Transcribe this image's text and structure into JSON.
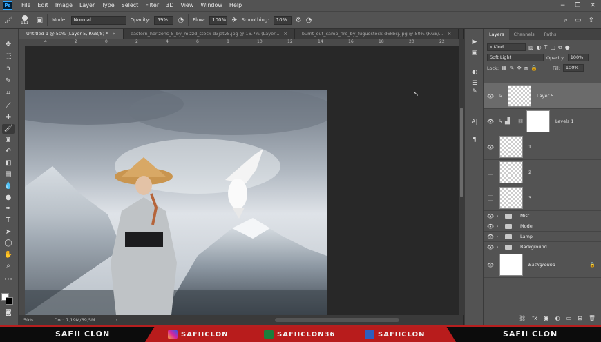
{
  "app": {
    "logo": "Ps"
  },
  "menu": [
    "File",
    "Edit",
    "Image",
    "Layer",
    "Type",
    "Select",
    "Filter",
    "3D",
    "View",
    "Window",
    "Help"
  ],
  "window_controls": [
    "−",
    "❐",
    "✕"
  ],
  "options": {
    "brush_size": "111",
    "mode_label": "Mode:",
    "mode_value": "Normal",
    "opacity_label": "Opacity:",
    "opacity_value": "59%",
    "flow_label": "Flow:",
    "flow_value": "100%",
    "smoothing_label": "Smoothing:",
    "smoothing_value": "10%"
  },
  "tabs": [
    {
      "label": "Untitled-1 @ 50% (Layer 5, RGB/8) *",
      "active": true
    },
    {
      "label": "eastern_horizons_5_by_mizzd_stock-d3jatv5.jpg @ 16.7% (Layer...",
      "active": false
    },
    {
      "label": "burnt_out_camp_fire_by_fuguestock-d6kbcj.jpg @ 50% (RGB/...",
      "active": false
    }
  ],
  "ruler_numbers": [
    "4",
    "2",
    "0",
    "2",
    "4",
    "6",
    "8",
    "10",
    "12",
    "14",
    "16",
    "18",
    "20",
    "22"
  ],
  "status": {
    "zoom": "50%",
    "doc": "Doc: 7,19M/69,5M"
  },
  "layers_panel": {
    "tabs": [
      "Layers",
      "Channels",
      "Paths"
    ],
    "kind_label": "Kind",
    "blend_mode": "Soft Light",
    "opacity_label": "Opacity:",
    "opacity_value": "100%",
    "lock_label": "Lock:",
    "fill_label": "Fill:",
    "fill_value": "100%",
    "layers": [
      {
        "name": "Layer 5",
        "visible": true,
        "selected": true,
        "type": "pixel"
      },
      {
        "name": "Levels 1",
        "visible": true,
        "selected": false,
        "type": "adjust"
      },
      {
        "name": "1",
        "visible": true,
        "selected": false,
        "type": "pixel"
      },
      {
        "name": "2",
        "visible": false,
        "selected": false,
        "type": "pixel"
      },
      {
        "name": "3",
        "visible": false,
        "selected": false,
        "type": "pixel"
      },
      {
        "name": "Mist",
        "visible": true,
        "type": "group"
      },
      {
        "name": "Model",
        "visible": true,
        "type": "group"
      },
      {
        "name": "Lamp",
        "visible": true,
        "type": "group"
      },
      {
        "name": "Background",
        "visible": true,
        "type": "group"
      },
      {
        "name": "Background",
        "visible": true,
        "type": "background"
      }
    ]
  },
  "banner": {
    "left": "SAFII CLON",
    "instagram": "SAFIICLON",
    "xing": "SAFIICLON36",
    "facebook": "SAFIICLON",
    "right": "SAFII CLON"
  }
}
